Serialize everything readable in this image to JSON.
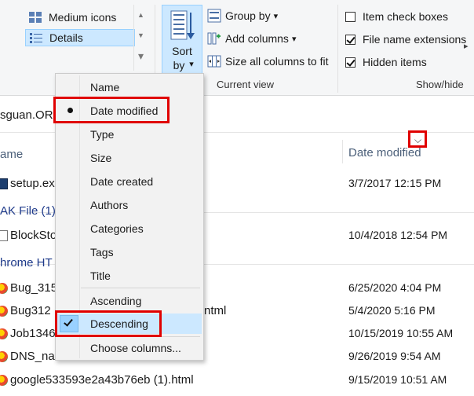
{
  "ribbon": {
    "layout": {
      "items": [
        {
          "label": "Medium icons",
          "selected": false
        },
        {
          "label": "Details",
          "selected": true
        }
      ],
      "scroll_up": "▲",
      "scroll_down": "▼",
      "expand": "▾"
    },
    "sort_by": {
      "line1": "Sort",
      "line2": "by",
      "arrow": "▾"
    },
    "current_view": {
      "group_label": "Current view",
      "items": [
        {
          "label": "Group by",
          "arrow": "▾"
        },
        {
          "label": "Add columns",
          "arrow": "▾"
        },
        {
          "label": "Size all columns to fit"
        }
      ]
    },
    "show_hide": {
      "group_label": "Show/hide",
      "items": [
        {
          "label": "Item check boxes",
          "checked": false
        },
        {
          "label": "File name extensions",
          "checked": true
        },
        {
          "label": "Hidden items",
          "checked": true
        }
      ]
    },
    "scroll_right": "▸"
  },
  "address": {
    "text": "sguan.OR"
  },
  "columns": {
    "name": "ame",
    "date": "Date modified",
    "chevron": "⌵"
  },
  "files": [
    {
      "name": "setup.ex",
      "date": "3/7/2017 12:15 PM",
      "icon": "exe"
    },
    {
      "group": "AK File (1)"
    },
    {
      "name": "BlockSto",
      "date": "10/4/2018 12:54 PM",
      "icon": "doc"
    },
    {
      "group": "hrome HT"
    },
    {
      "name": "Bug_315",
      "date": "6/25/2020 4:04 PM",
      "icon": "chrome"
    },
    {
      "name": "Bug312",
      "tail": "ntml",
      "date": "5/4/2020 5:16 PM",
      "icon": "chrome"
    },
    {
      "name": "Job1346",
      "date": "10/15/2019 10:55 AM",
      "icon": "chrome"
    },
    {
      "name": "DNS_nam",
      "date": "9/26/2019 9:54 AM",
      "icon": "chrome"
    },
    {
      "name": "google533593e2a43b76eb (1).html",
      "date": "9/15/2019 10:51 AM",
      "icon": "chrome"
    }
  ],
  "sort_menu": {
    "fields": [
      {
        "label": "Name",
        "active": false
      },
      {
        "label": "Date modified",
        "active": true
      },
      {
        "label": "Type",
        "active": false
      },
      {
        "label": "Size",
        "active": false
      },
      {
        "label": "Date created",
        "active": false
      },
      {
        "label": "Authors",
        "active": false
      },
      {
        "label": "Categories",
        "active": false
      },
      {
        "label": "Tags",
        "active": false
      },
      {
        "label": "Title",
        "active": false
      }
    ],
    "order": [
      {
        "label": "Ascending",
        "active": false
      },
      {
        "label": "Descending",
        "active": true
      }
    ],
    "choose_columns": "Choose columns..."
  },
  "colors": {
    "highlight_red": "#e00000",
    "selection_blue": "#cce8ff"
  }
}
